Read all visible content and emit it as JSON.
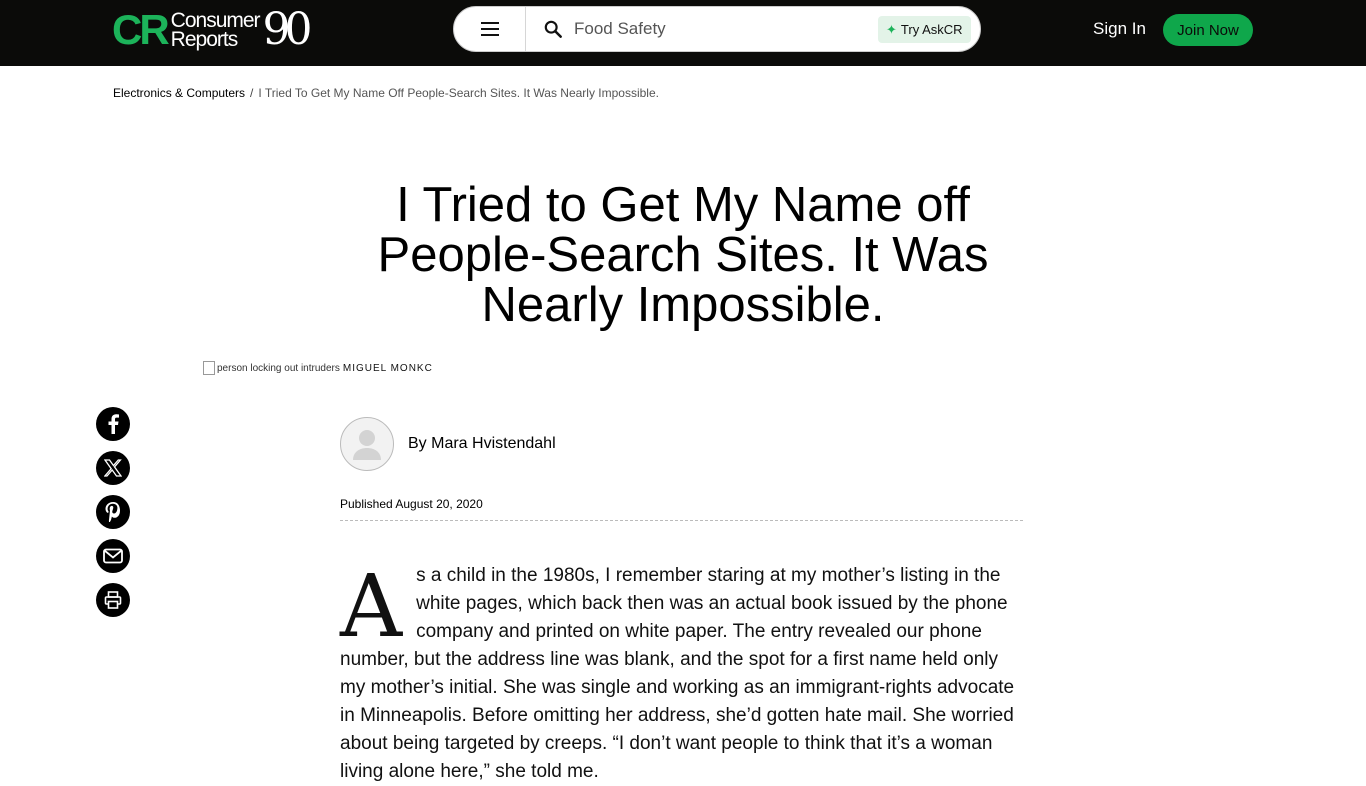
{
  "header": {
    "logo_cr": "CR",
    "logo_line1": "Consumer",
    "logo_line2": "Reports",
    "logo_badge": "90",
    "search_value": "Food Safety",
    "askcr_label": "Try AskCR",
    "signin_label": "Sign In",
    "join_label": "Join Now"
  },
  "breadcrumb": {
    "section": "Electronics & Computers",
    "separator": "/",
    "current": "I Tried To Get My Name Off People-Search Sites. It Was Nearly Impossible."
  },
  "article": {
    "title": "I Tried to Get My Name off People-Search Sites. It Was Nearly Impossible.",
    "image_alt": "person locking out intruders",
    "image_credit": "MIGUEL MONKC",
    "byline_prefix": "By",
    "author": "Mara Hvistendahl",
    "published": "Published August 20, 2020",
    "dropcap": "A",
    "body": "s a child in the 1980s, I remember staring at my mother’s listing in the white pages, which back then was an actual book issued by the phone company and printed on white paper. The entry revealed our phone number, but the address line was blank, and the spot for a first name held only my mother’s initial. She was single and working as an immigrant-rights advocate in Minneapolis. Before omitting her address, she’d gotten hate mail. She worried about being targeted by creeps. “I don’t want people to think that it’s a woman living alone here,” she told me."
  },
  "social": [
    "facebook-icon",
    "x-icon",
    "pinterest-icon",
    "email-icon",
    "print-icon"
  ],
  "colors": {
    "header_bg": "#0b0b09",
    "brand_green": "#1cb35a",
    "join_green": "#0fa74b",
    "askcr_bg": "#e3f3e8"
  }
}
